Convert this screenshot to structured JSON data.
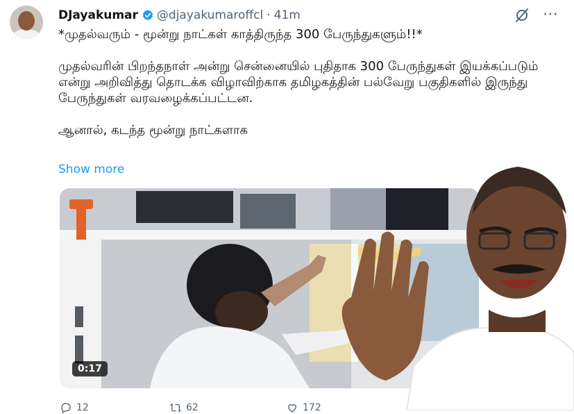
{
  "tweet": {
    "display_name": "DJayakumar",
    "handle": "@djayakumaroffcl",
    "separator": "·",
    "time": "41m",
    "paragraph1": "*முதல்வரும் - மூன்று நாட்கள் காத்திருந்த 300 பேருந்துகளும்!!*",
    "paragraph2": "முதல்வரின் பிறந்தநாள் அன்று சென்னையில் புதிதாக 300 பேருந்துகள் இயக்கப்படும் என்று அறிவித்து தொடக்க விழாவிற்காக  தமிழகத்தின் பல்வேறு பகுதிகளில் இருந்து பேருந்துகள் வரவழைக்கப்பட்டன.",
    "paragraph3": "ஆனால், கடந்த மூன்று நாட்களாக",
    "show_more": "Show more",
    "more_icon": "⋯"
  },
  "media": {
    "duration": "0:17"
  },
  "actions": {
    "replies": "12",
    "retweets": "62",
    "likes": "172"
  },
  "colors": {
    "accent": "#1d9bf0",
    "secondary_text": "#536471",
    "verified": "#1d9bf0"
  }
}
